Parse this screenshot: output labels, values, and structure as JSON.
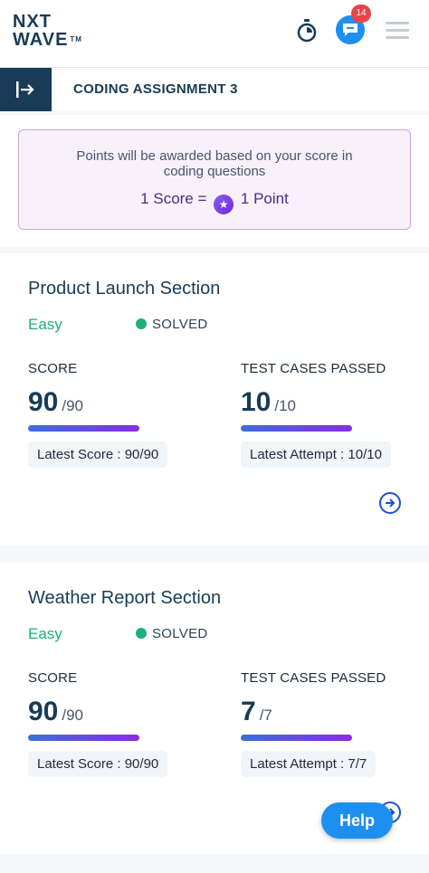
{
  "header": {
    "logo_line1": "NXT",
    "logo_line2": "WAVE",
    "logo_tm": "TM",
    "notification_count": "14",
    "icons": [
      "stopwatch-icon",
      "chat-icon",
      "hamburger-menu-icon"
    ]
  },
  "assignment": {
    "title": "CODING ASSIGNMENT 3"
  },
  "info": {
    "message": "Points will be awarded based on your score in coding questions",
    "score_left": "1 Score =",
    "score_right": "1 Point"
  },
  "sections": [
    {
      "title": "Product Launch Section",
      "difficulty": "Easy",
      "status": "SOLVED",
      "score_label": "SCORE",
      "score": "90",
      "score_total": "/90",
      "tests_label": "TEST CASES PASSED",
      "tests": "10",
      "tests_total": "/10",
      "latest_score": "Latest Score : 90/90",
      "latest_attempt": "Latest Attempt : 10/10"
    },
    {
      "title": "Weather Report Section",
      "difficulty": "Easy",
      "status": "SOLVED",
      "score_label": "SCORE",
      "score": "90",
      "score_total": "/90",
      "tests_label": "TEST CASES PASSED",
      "tests": "7",
      "tests_total": "/7",
      "latest_score": "Latest Score : 90/90",
      "latest_attempt": "Latest Attempt : 7/7"
    }
  ],
  "help_label": "Help",
  "colors": {
    "brand_navy": "#183b56",
    "accent_blue": "#1d8ff0",
    "easy_green": "#1fae7a",
    "badge_red": "#e84545"
  }
}
